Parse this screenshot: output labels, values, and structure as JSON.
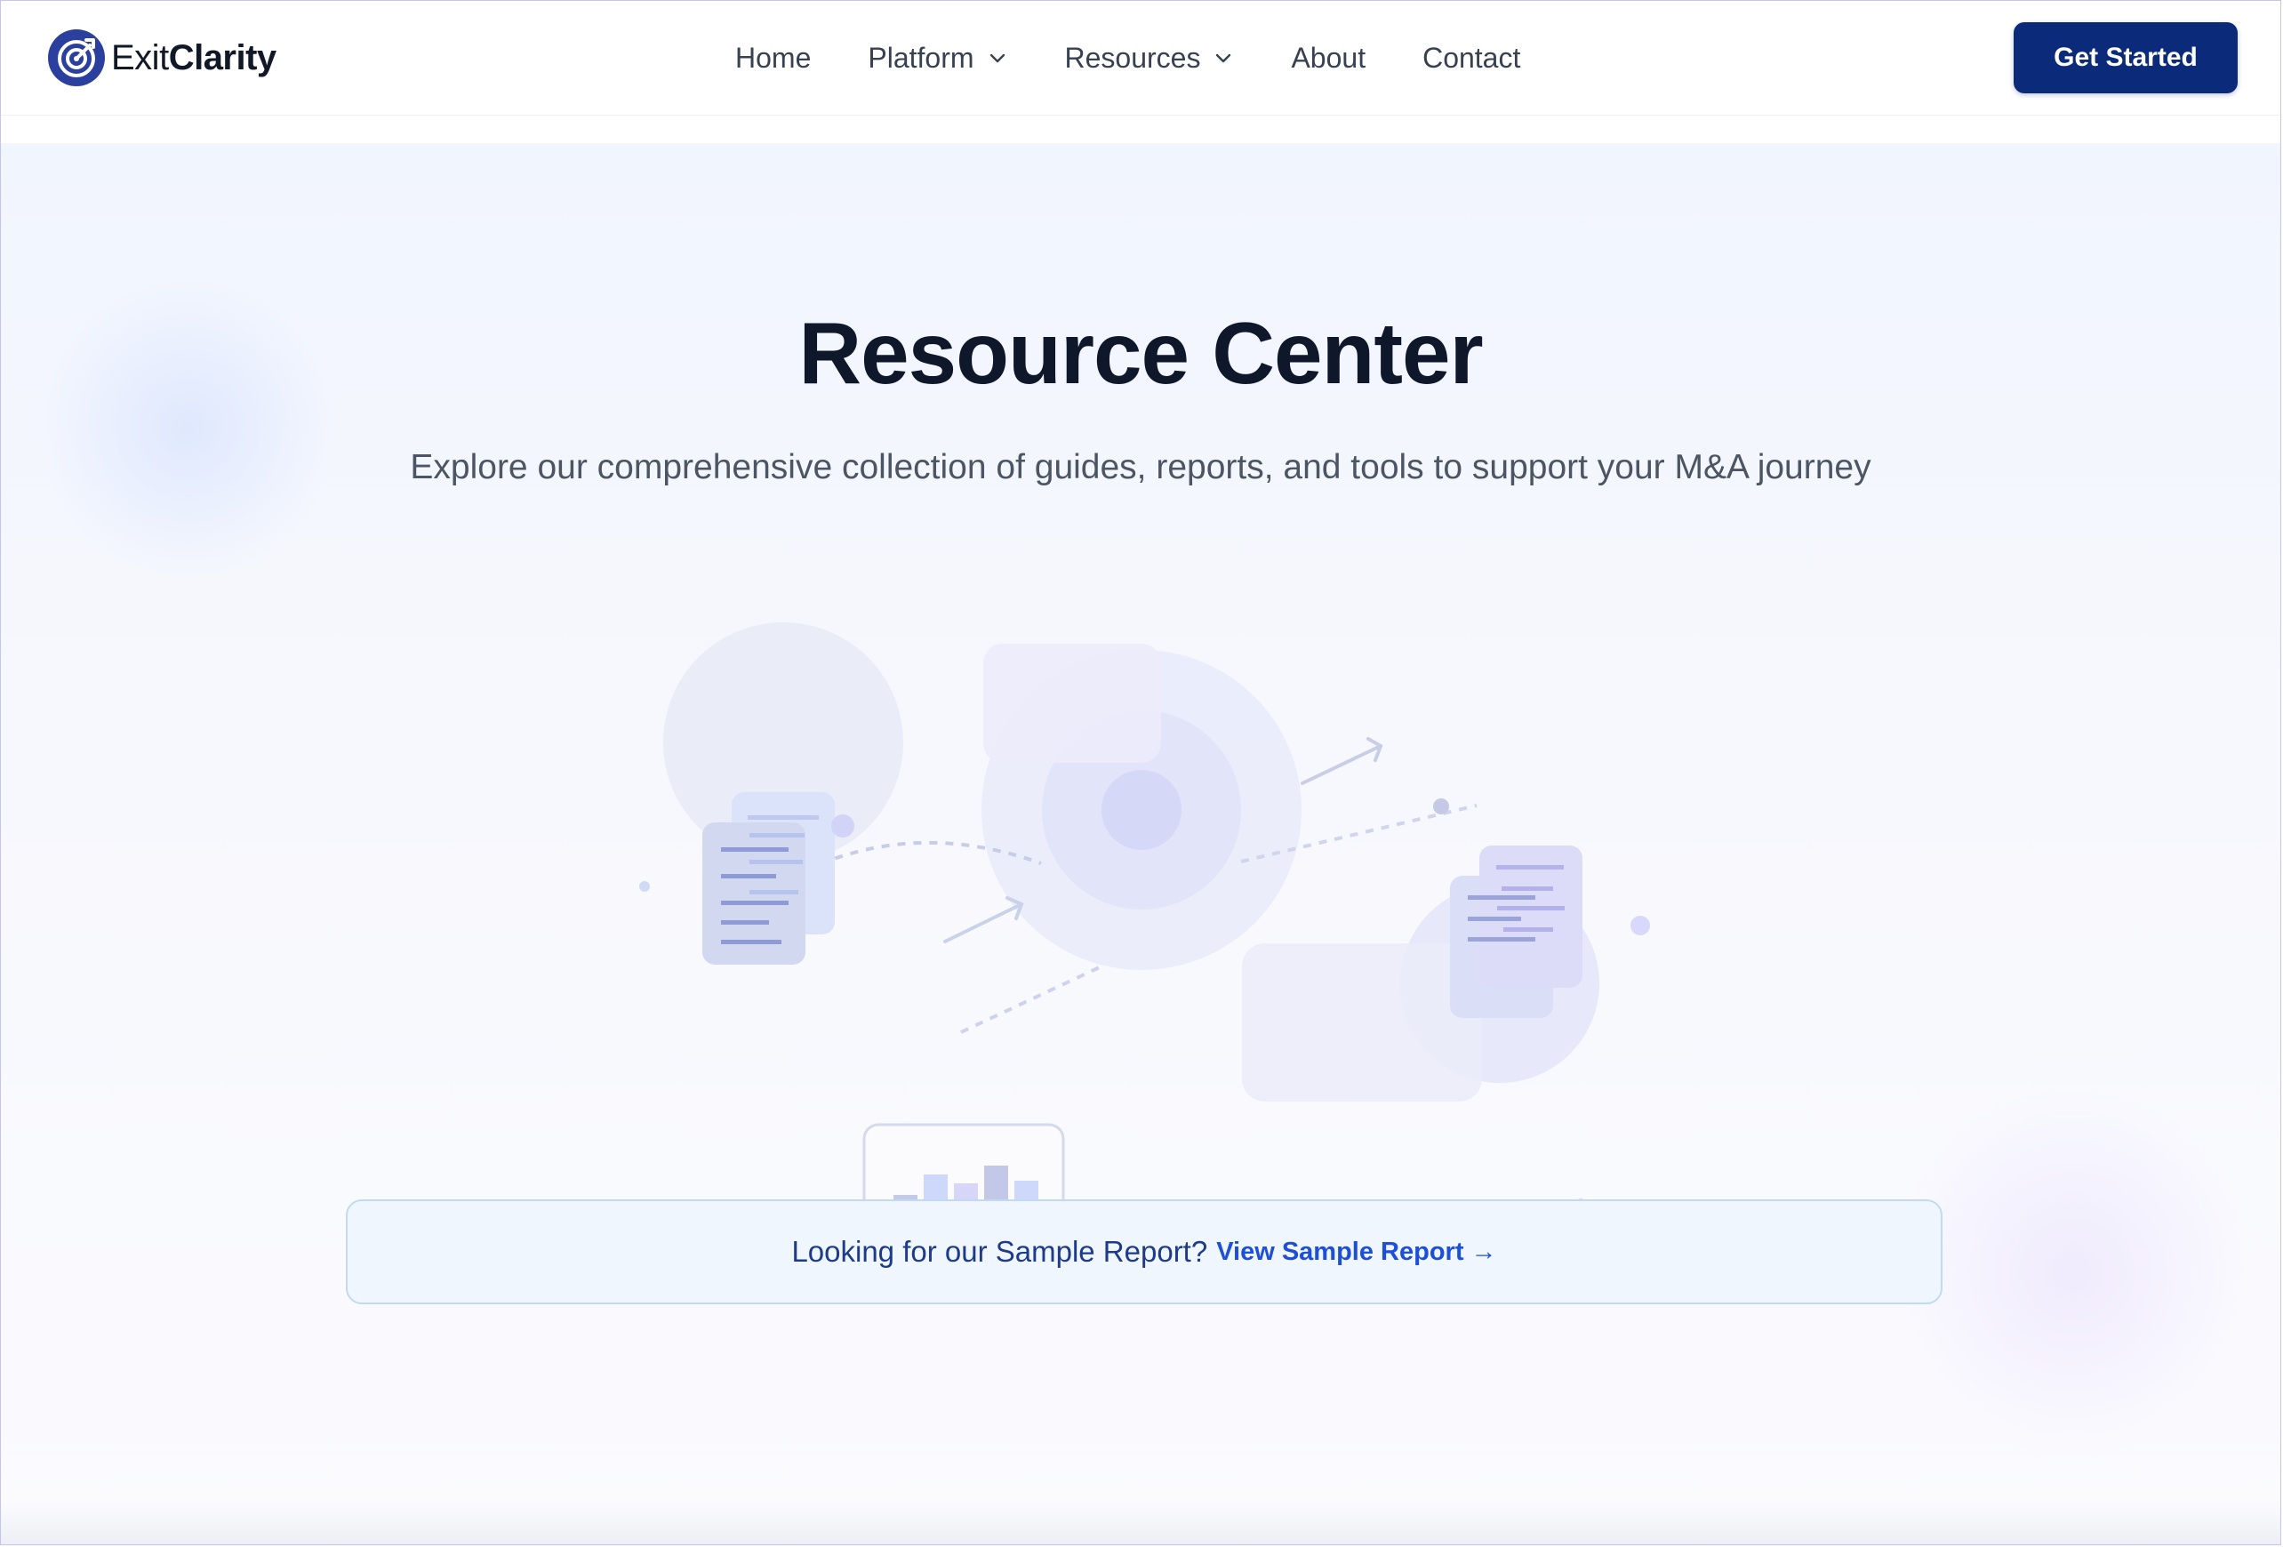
{
  "brand": {
    "name_light": "Exit",
    "name_bold": "Clarity",
    "color": "#0b2a7a"
  },
  "nav": {
    "items": [
      {
        "label": "Home",
        "dropdown": false
      },
      {
        "label": "Platform",
        "dropdown": true
      },
      {
        "label": "Resources",
        "dropdown": true
      },
      {
        "label": "About",
        "dropdown": false
      },
      {
        "label": "Contact",
        "dropdown": false
      }
    ],
    "cta_label": "Get Started"
  },
  "hero": {
    "title": "Resource Center",
    "subtitle": "Explore our comprehensive collection of guides, reports, and tools to support your M&A journey"
  },
  "callout": {
    "text": "Looking for our Sample Report?",
    "link_label": "View Sample Report →"
  },
  "icons": [
    "logo-target-icon",
    "chevron-down-icon",
    "arrow-right-icon"
  ],
  "colors": {
    "accent": "#1d4fd8",
    "brand_navy": "#0b2a7a",
    "callout_bg": "#eff6fd"
  }
}
